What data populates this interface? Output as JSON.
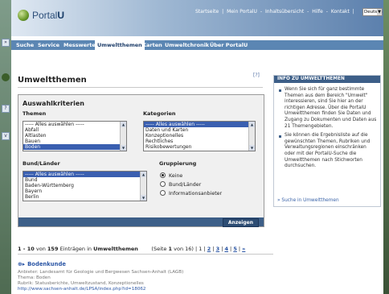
{
  "app": {
    "logo_text": "Portal",
    "logo_bold": "U"
  },
  "topnav": {
    "items": [
      "Startseite",
      "|",
      "Mein PortalU",
      "-",
      "Inhaltsübersicht",
      "-",
      "Hilfe",
      "-",
      "Kontakt",
      "|"
    ],
    "language": "Deutsch"
  },
  "mainnav": {
    "items": [
      "Suche",
      "Service",
      "Messwerte",
      "Umweltthemen",
      "Karten",
      "Umweltchronik",
      "Über PortalU"
    ],
    "active": "Umweltthemen"
  },
  "page": {
    "title": "Umweltthemen",
    "help": "[?]"
  },
  "panel": {
    "heading": "Auswahlkriterien",
    "themen": {
      "label": "Themen",
      "options": [
        "----- Alles auswählen -----",
        "Abfall",
        "Altlasten",
        "Bauen",
        "Boden"
      ],
      "selected": "Boden"
    },
    "kategorien": {
      "label": "Kategorien",
      "options": [
        "----- Alles auswählen -----",
        "Daten und Karten",
        "Konzeptionelles",
        "Rechtliches",
        "Risikobewertungen"
      ],
      "selected": "----- Alles auswählen -----"
    },
    "bundlaender": {
      "label": "Bund/Länder",
      "options": [
        "----- Alles auswählen -----",
        "Bund",
        "Baden-Württemberg",
        "Bayern",
        "Berlin"
      ],
      "selected": "----- Alles auswählen -----"
    },
    "gruppierung": {
      "label": "Gruppierung",
      "options": [
        "Keine",
        "Bund/Länder",
        "Informationsanbieter"
      ],
      "selected": "Keine"
    },
    "submit": "Anzeigen"
  },
  "info": {
    "heading": "INFO ZU UMWELTTHEMEN",
    "bullets": [
      "Wenn Sie sich für ganz bestimmte Themen aus dem Bereich \"Umwelt\" interessieren, sind Sie hier an der richtigen Adresse. Über die PortalU Umweltthemen finden Sie Daten und Zugang zu Dokumenten und Daten aus 21 Themengebieten.",
      "Sie können die Ergebnisliste auf die gewünschten Themen, Rubriken und Verwaltungsregionen einschränken oder mit der PortalU-Suche die Umweltthemen nach Stichworten durchsuchen."
    ],
    "link": "»  Suche in Umweltthemen"
  },
  "results": {
    "range": "1 - 10",
    "von": "von",
    "total": "159",
    "suffix": "Einträgen in",
    "topic": "Umweltthemen",
    "seite": "(Seite",
    "page": "1",
    "von_pages": "von 16) | 1 |",
    "pages": [
      "2",
      "3",
      "4",
      "5",
      "»"
    ]
  },
  "hit": {
    "title": "Bodenkunde",
    "anbieter": "Anbieter: Landesamt für Geologie und Bergwesen Sachsen-Anhalt (LAGB)",
    "thema": "Thema: Boden",
    "rubrik": "Rubrik: Statusberichte, Umweltzustand, Konzeptionelles",
    "url": "http://www.sachsen-anhalt.de/LPSA/index.php?id=18062"
  }
}
